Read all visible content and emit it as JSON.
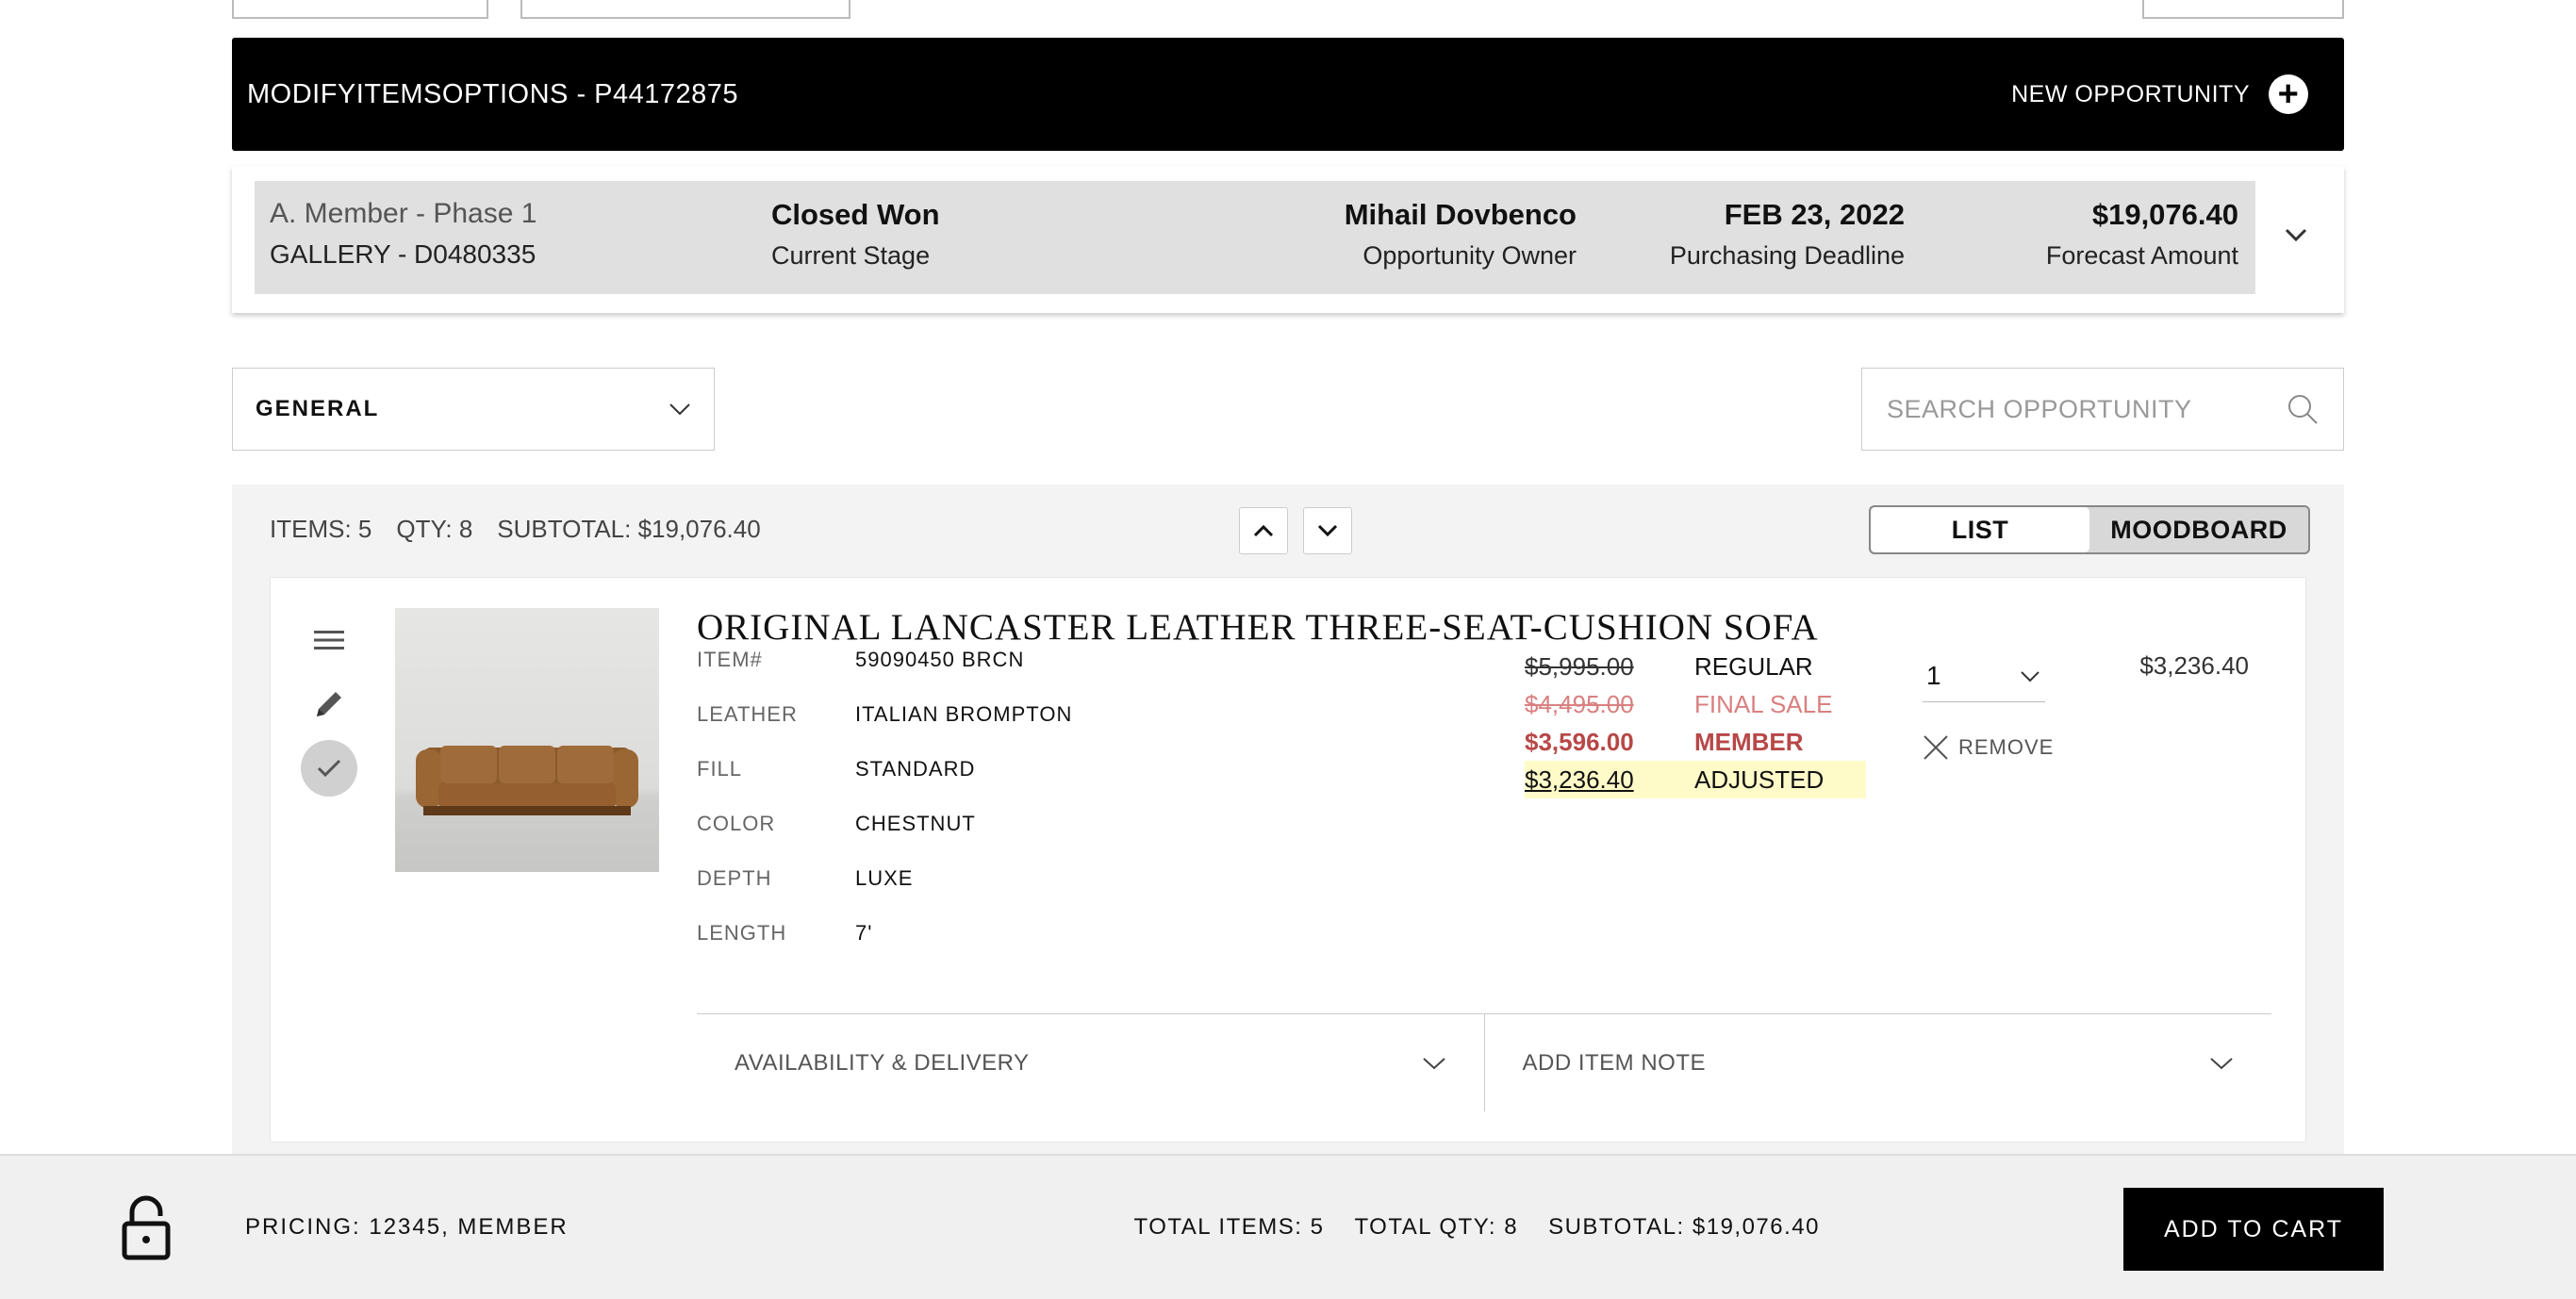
{
  "header": {
    "title": "MODIFYITEMSOPTIONS - P44172875",
    "new_opportunity_label": "NEW OPPORTUNITY",
    "bg_color": "#000000"
  },
  "summary": {
    "member_phase": "A. Member - Phase 1",
    "gallery": "GALLERY - D0480335",
    "stage_value": "Closed Won",
    "stage_label": "Current Stage",
    "owner_value": "Mihail Dovbenco",
    "owner_label": "Opportunity Owner",
    "deadline_value": "FEB 23, 2022",
    "deadline_label": "Purchasing Deadline",
    "forecast_value": "$19,076.40",
    "forecast_label": "Forecast Amount"
  },
  "filters": {
    "category_selected": "GENERAL",
    "search_placeholder": "SEARCH OPPORTUNITY"
  },
  "items_bar": {
    "items": "ITEMS: 5",
    "qty": "QTY: 8",
    "subtotal": "SUBTOTAL: $19,076.40",
    "view_list": "LIST",
    "view_moodboard": "MOODBOARD",
    "active_view": "LIST"
  },
  "item": {
    "title": "ORIGINAL LANCASTER LEATHER THREE-SEAT-CUSHION SOFA",
    "specs": [
      {
        "label": "ITEM#",
        "value": "59090450 BRCN"
      },
      {
        "label": "LEATHER",
        "value": "ITALIAN BROMPTON"
      },
      {
        "label": "FILL",
        "value": "STANDARD"
      },
      {
        "label": "COLOR",
        "value": "CHESTNUT"
      },
      {
        "label": "DEPTH",
        "value": "LUXE"
      },
      {
        "label": "LENGTH",
        "value": "7'"
      }
    ],
    "prices": {
      "regular": {
        "price": "$5,995.00",
        "label": "REGULAR"
      },
      "final_sale": {
        "price": "$4,495.00",
        "label": "FINAL SALE"
      },
      "member": {
        "price": "$3,596.00",
        "label": "MEMBER"
      },
      "adjusted": {
        "price": "$3,236.40",
        "label": "ADJUSTED"
      }
    },
    "quantity": "1",
    "remove_label": "REMOVE",
    "line_total": "$3,236.40",
    "availability_label": "AVAILABILITY & DELIVERY",
    "note_label": "ADD ITEM NOTE"
  },
  "footer": {
    "pricing": "PRICING: 12345, MEMBER",
    "total_items": "TOTAL ITEMS: 5",
    "total_qty": "TOTAL QTY: 8",
    "subtotal": "SUBTOTAL: $19,076.40",
    "add_to_cart_label": "ADD TO CART"
  },
  "colors": {
    "member_price": "#b84747",
    "final_sale": "#d98080",
    "adjusted_highlight": "#fffbc8"
  }
}
